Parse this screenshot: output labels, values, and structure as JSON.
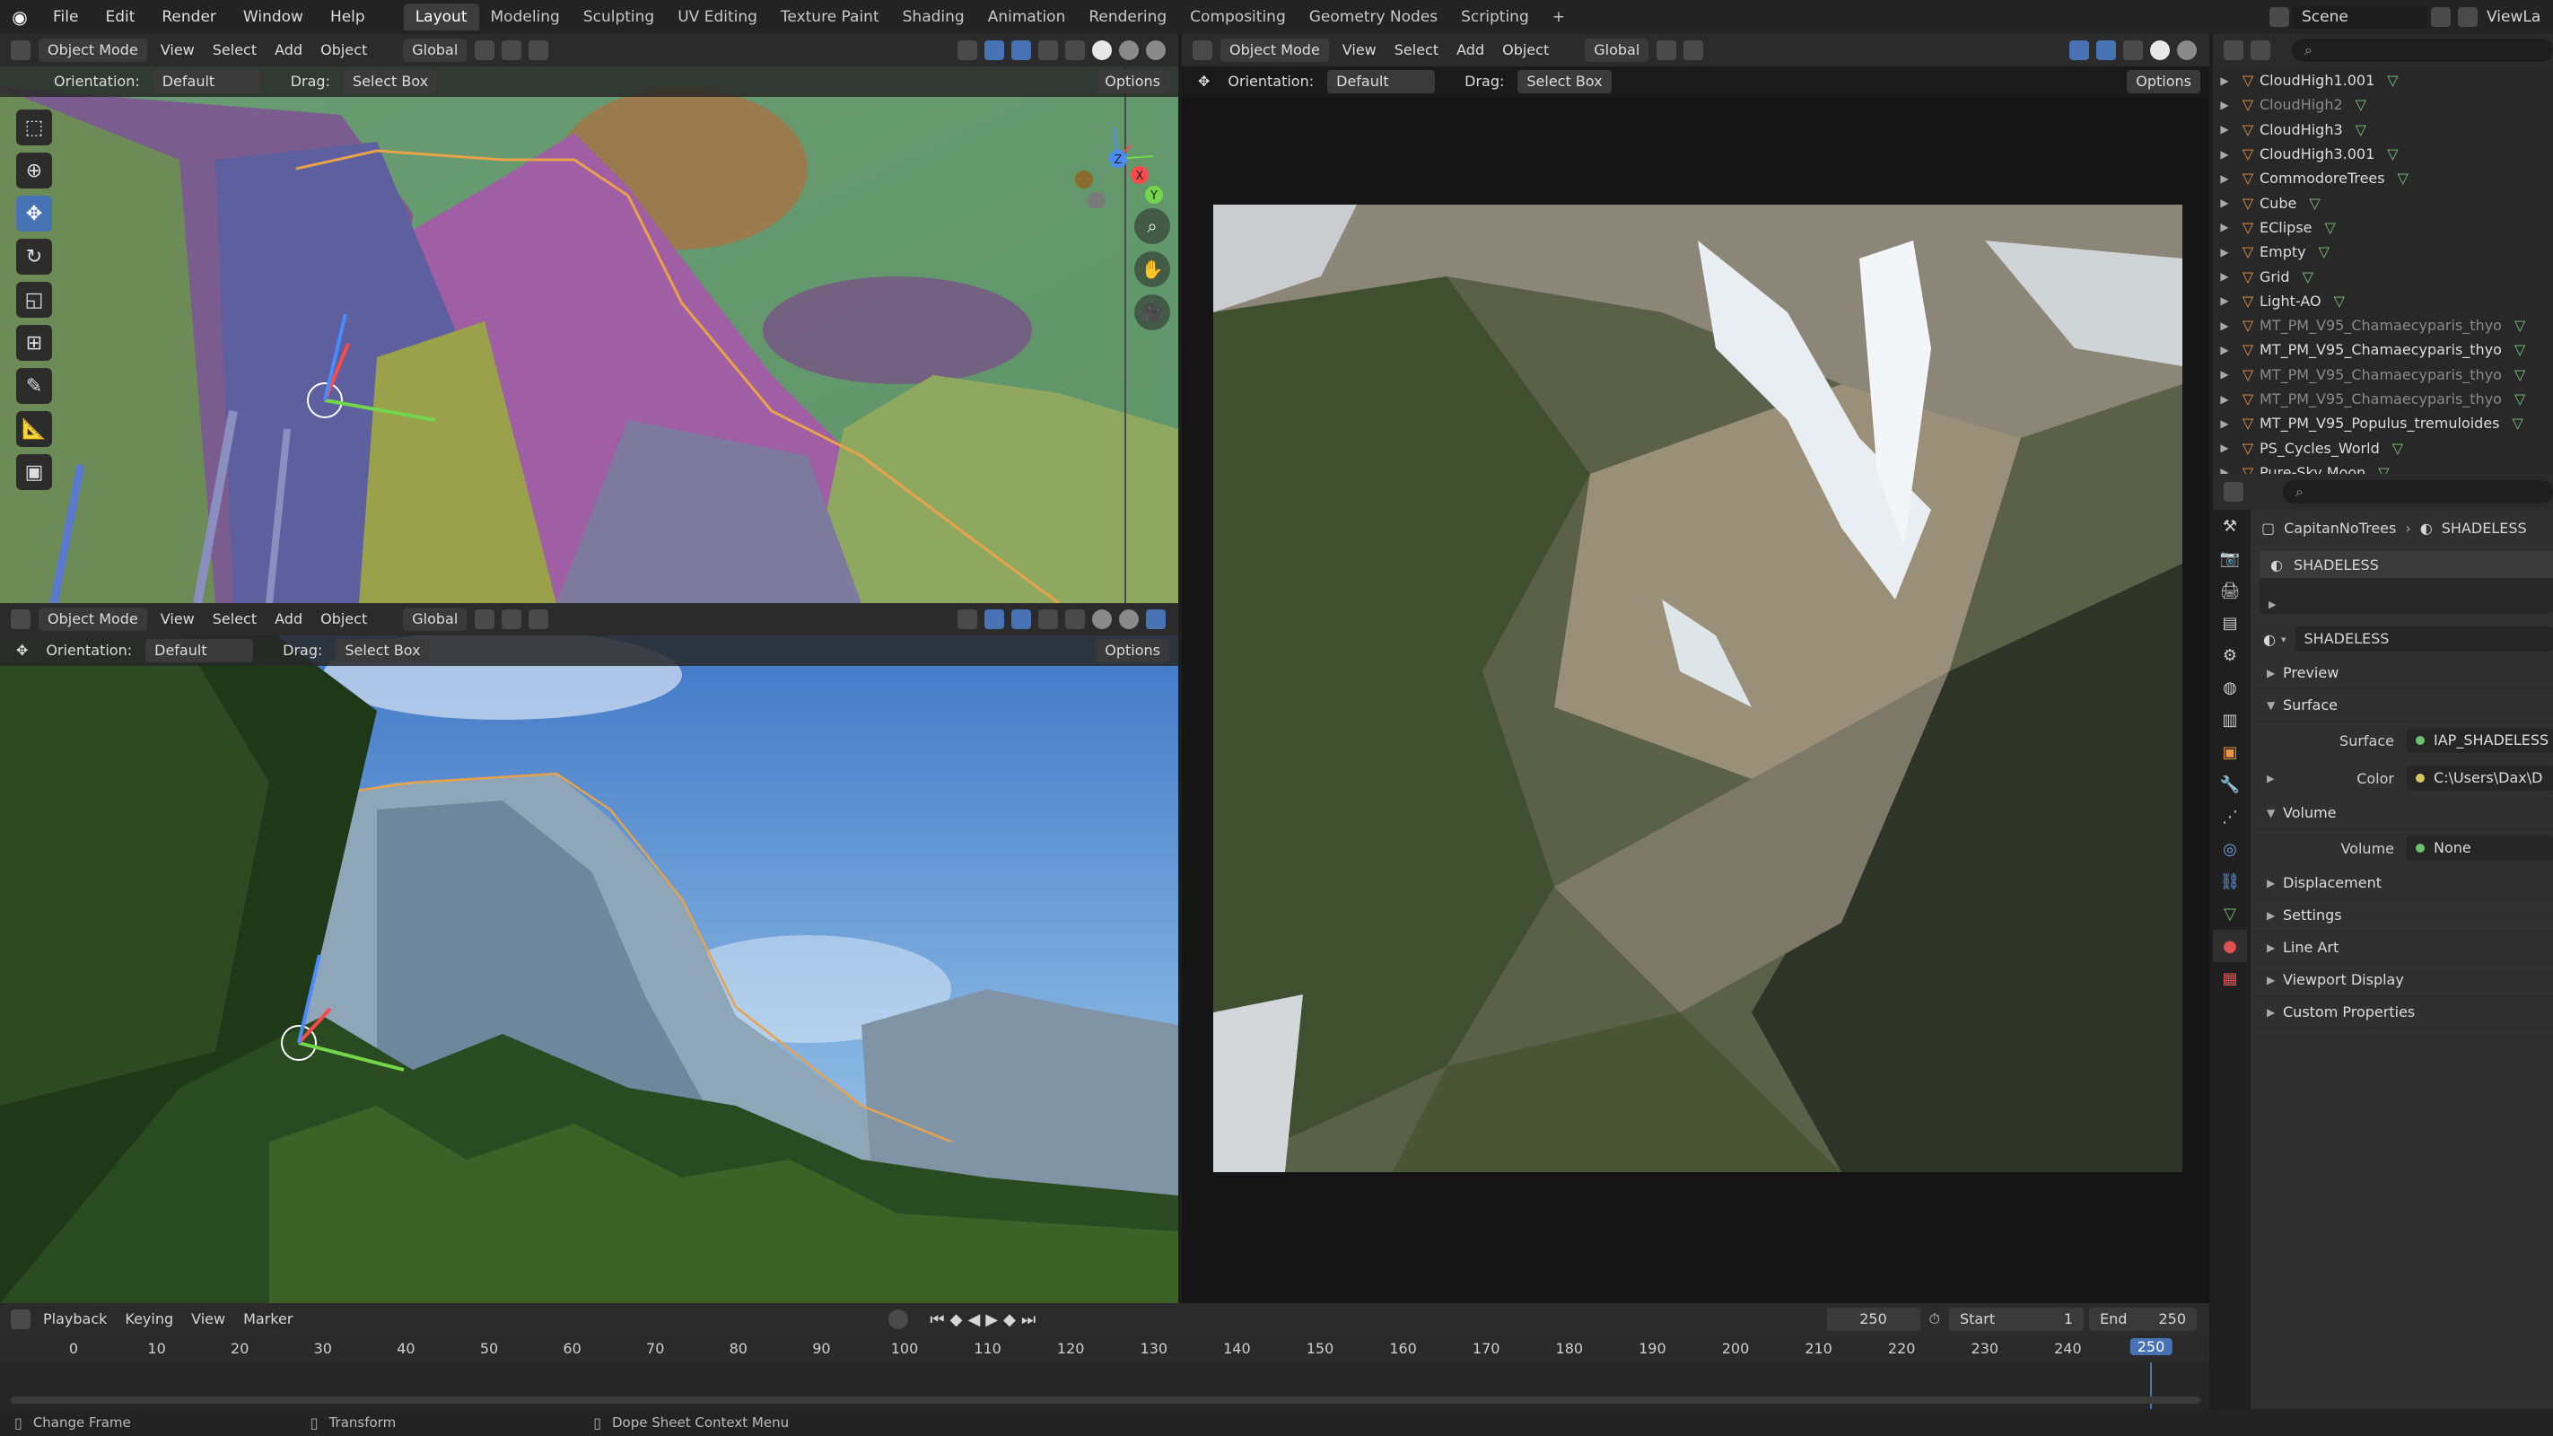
{
  "menu": [
    "File",
    "Edit",
    "Render",
    "Window",
    "Help"
  ],
  "workspaces": [
    "Layout",
    "Modeling",
    "Sculpting",
    "UV Editing",
    "Texture Paint",
    "Shading",
    "Animation",
    "Rendering",
    "Compositing",
    "Geometry Nodes",
    "Scripting"
  ],
  "workspace_add": "+",
  "scene_label": "Scene",
  "viewlayer_label": "ViewLa",
  "viewport_header": {
    "mode": "Object Mode",
    "view": "View",
    "select": "Select",
    "add": "Add",
    "object": "Object",
    "transform": "Global",
    "orientation_label": "Orientation:",
    "orientation_value": "Default",
    "drag_label": "Drag:",
    "drag_value": "Select Box",
    "options": "Options"
  },
  "gizmo_axes": {
    "x": "X",
    "y": "Y",
    "z": "Z"
  },
  "outliner": {
    "items": [
      {
        "name": "CloudHigh1.001",
        "dim": false
      },
      {
        "name": "CloudHigh2",
        "dim": true
      },
      {
        "name": "CloudHigh3",
        "dim": false
      },
      {
        "name": "CloudHigh3.001",
        "dim": false
      },
      {
        "name": "CommodoreTrees",
        "dim": false
      },
      {
        "name": "Cube",
        "dim": false
      },
      {
        "name": "EClipse",
        "dim": false
      },
      {
        "name": "Empty",
        "dim": false
      },
      {
        "name": "Grid",
        "dim": false
      },
      {
        "name": "Light-AO",
        "dim": false
      },
      {
        "name": "MT_PM_V95_Chamaecyparis_thyo",
        "dim": true
      },
      {
        "name": "MT_PM_V95_Chamaecyparis_thyo",
        "dim": false
      },
      {
        "name": "MT_PM_V95_Chamaecyparis_thyo",
        "dim": true
      },
      {
        "name": "MT_PM_V95_Chamaecyparis_thyo",
        "dim": true
      },
      {
        "name": "MT_PM_V95_Populus_tremuloides",
        "dim": false
      },
      {
        "name": "PS_Cycles_World",
        "dim": false
      },
      {
        "name": "Pure-Sky Moon",
        "dim": false
      }
    ]
  },
  "properties": {
    "breadcrumb_object": "CapitanNoTrees",
    "breadcrumb_material": "SHADELESS",
    "slot_name": "SHADELESS",
    "material_name": "SHADELESS",
    "sections": {
      "preview": "Preview",
      "surface": "Surface",
      "volume": "Volume",
      "displacement": "Displacement",
      "settings": "Settings",
      "line_art": "Line Art",
      "viewport_display": "Viewport Display",
      "custom_properties": "Custom Properties"
    },
    "surface_label": "Surface",
    "surface_value": "IAP_SHADELESS",
    "color_label": "Color",
    "color_value": "C:\\Users\\Dax\\D",
    "volume_label": "Volume",
    "volume_value": "None"
  },
  "timeline": {
    "playback": "Playback",
    "keying": "Keying",
    "view": "View",
    "marker": "Marker",
    "current_frame": "250",
    "start_label": "Start",
    "start_value": "1",
    "end_label": "End",
    "end_value": "250",
    "ticks": [
      "0",
      "10",
      "20",
      "30",
      "40",
      "50",
      "60",
      "70",
      "80",
      "90",
      "100",
      "110",
      "120",
      "130",
      "140",
      "150",
      "160",
      "170",
      "180",
      "190",
      "200",
      "210",
      "220",
      "230",
      "240"
    ],
    "playhead": "250"
  },
  "statusbar": {
    "change_frame": "Change Frame",
    "transform": "Transform",
    "context_menu": "Dope Sheet Context Menu"
  },
  "colors": {
    "accent": "#4772b3",
    "header_bg": "#2b2b2b",
    "panel_bg": "#303030",
    "object_orange": "#e7954a",
    "visibility_green": "#7ec67e"
  }
}
